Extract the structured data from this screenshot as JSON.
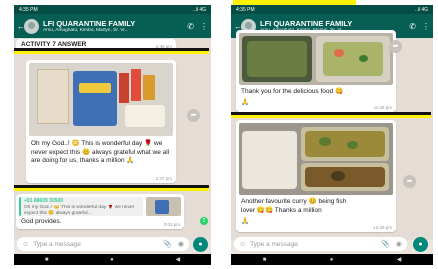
{
  "left_phone": {
    "status": {
      "time": "4:35 PM",
      "signal": "..il 4G"
    },
    "header": {
      "title": "LFI QUARANTINE FAMILY",
      "members": "Amu, Amughato, Kimbo, Marlyn, Sr. Vi..."
    },
    "activity": {
      "text": "ACTIVITY 7 ANSWER",
      "time": "2:46 pm"
    },
    "message": {
      "text": "Oh my God..! 😳 This is wonderful day 🌹 we never expect this 😊 always grateful what we all are doing for us, thanks a million 🙏",
      "time": "2:47 pm"
    },
    "reply": {
      "sender": "+91 88609 30500",
      "quoted": "Oh my God..! 😳 This is wonderful day 🌹 we never expect this 😊 always grateful...",
      "text": "God provides.",
      "time": "3:03 pm"
    },
    "unread_count": "2",
    "input_placeholder": "Type a message"
  },
  "right_phone": {
    "status": {
      "time": "4:35 PM",
      "signal": "..il 4G"
    },
    "header": {
      "title": "LFI QUARANTINE FAMILY",
      "members": "Amu, Amughato, Kimbo, Marlyn, Sr. Vi..."
    },
    "message1": {
      "text": "Thank you for the delicious food 😋",
      "emoji": "🙏",
      "time": "11:38 pm"
    },
    "message2": {
      "text": "Another favourite curry 😊 being fish lover 😋😋 Thanks a million",
      "emoji": "🙏",
      "time": "12:39 pm"
    },
    "input_placeholder": "Type a message"
  },
  "colors": {
    "header": "#075e54",
    "chat_bg": "#e5ddd5",
    "accent": "#00897b",
    "highlight": "#fff200"
  },
  "icons": [
    "back-arrow-icon",
    "add-call-icon",
    "more-icon",
    "forward-icon",
    "emoji-icon",
    "attach-icon",
    "camera-icon",
    "mic-icon"
  ]
}
